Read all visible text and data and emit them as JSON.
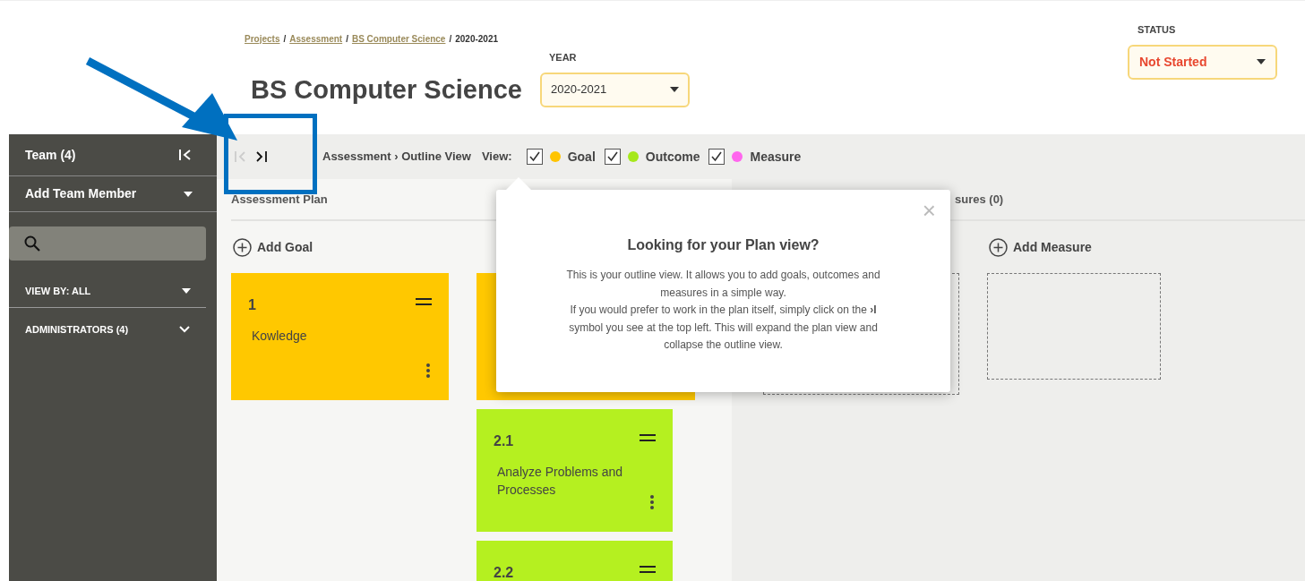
{
  "breadcrumb": [
    {
      "kind": "link",
      "label": "Projects"
    },
    {
      "kind": "separator",
      "label": "/"
    },
    {
      "kind": "link",
      "label": "Assessment"
    },
    {
      "kind": "separator",
      "label": "/"
    },
    {
      "kind": "link",
      "label": "BS Computer Science"
    },
    {
      "kind": "separator",
      "label": "/"
    },
    {
      "kind": "current",
      "label": "2020-2021"
    }
  ],
  "title": "BS Computer Science",
  "year": {
    "label": "YEAR",
    "value": "2020-2021"
  },
  "status": {
    "label": "STATUS",
    "value": "Not Started"
  },
  "sidebar": {
    "team": "Team (4)",
    "add_member": "Add Team Member",
    "view_by": "VIEW BY: ALL",
    "administrators": "ADMINISTRATORS (4)"
  },
  "toolbar": {
    "path": "Assessment › Outline View",
    "view_label": "View:",
    "filters": [
      {
        "label": "Goal",
        "checked": true,
        "color": "#ffc400"
      },
      {
        "label": "Outcome",
        "checked": true,
        "color": "#a6e81c"
      },
      {
        "label": "Measure",
        "checked": true,
        "color": "#ff66ee"
      }
    ]
  },
  "goal_column": {
    "header": "Assessment Plan",
    "add_label": "Add Goal",
    "cards": [
      {
        "kind": "goal",
        "number": "1",
        "text": "Kowledge"
      }
    ]
  },
  "outcome_column": {
    "cards": [
      {
        "kind": "goal"
      },
      {
        "kind": "outcome",
        "number": "2.1",
        "text": "Analyze Problems and Processes"
      },
      {
        "kind": "outcome",
        "number": "2.2"
      }
    ]
  },
  "measure_column": {
    "header": "sures (0)",
    "add_label": "Add Measure",
    "placeholders": [
      {
        "kind": "dashed"
      },
      {
        "kind": "dashed"
      }
    ]
  },
  "popup": {
    "title": "Looking for your Plan view?",
    "close": "×",
    "lines": [
      "This is your outline view. It allows you to add goals, outcomes and measures in a simple way.",
      "If you would prefer to work in the plan itself, simply click on the **›I** symbol you see at the top left. This will expand the plan view and collapse the outline view."
    ]
  }
}
